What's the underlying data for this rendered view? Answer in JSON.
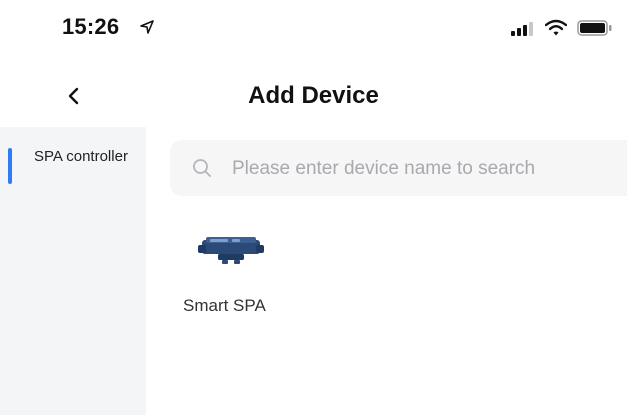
{
  "status_bar": {
    "time": "15:26",
    "icons": [
      "location-arrow-icon",
      "signal-bars-icon",
      "wifi-icon",
      "battery-icon"
    ]
  },
  "nav": {
    "back_icon": "chevron-left-icon",
    "title": "Add Device"
  },
  "sidebar": {
    "items": [
      {
        "label": "SPA controller",
        "selected": true
      }
    ]
  },
  "search": {
    "placeholder": "Please enter device name to search",
    "value": "",
    "icon": "search-icon"
  },
  "devices": [
    {
      "name": "Smart SPA",
      "icon": "spa-controller-device-image"
    }
  ],
  "colors": {
    "accent": "#2f7cf6",
    "sidebar_bg": "#f4f5f7",
    "search_bg": "#f6f6f7",
    "placeholder": "#a7a9ae",
    "device_body": "#2b4a78"
  }
}
